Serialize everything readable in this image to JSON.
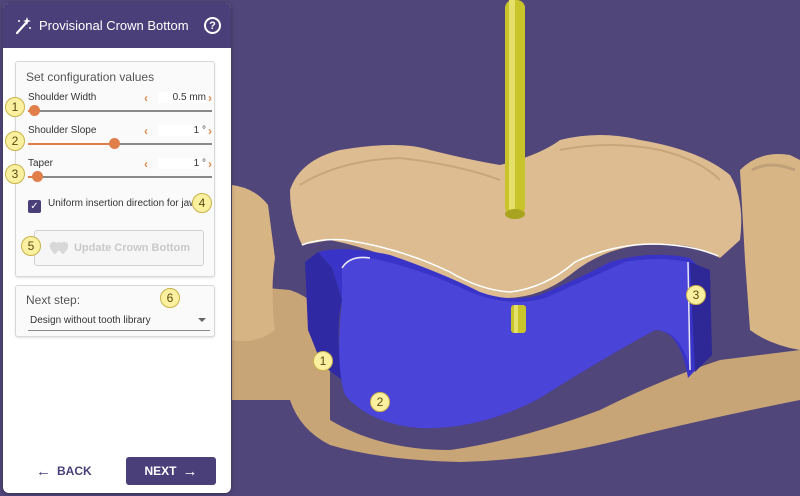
{
  "panel": {
    "title": "Provisional Crown Bottom",
    "help_icon": "?",
    "config": {
      "title": "Set configuration values",
      "params": [
        {
          "label": "Shoulder Width",
          "value": "0.5 mm",
          "fraction": 0.03
        },
        {
          "label": "Shoulder Slope",
          "value": "1 °",
          "fraction": 0.47
        },
        {
          "label": "Taper",
          "value": "1 °",
          "fraction": 0.05
        }
      ],
      "checkbox": {
        "label": "Uniform insertion direction for jaw",
        "checked": true
      },
      "update_button": "Update Crown Bottom"
    },
    "next_step": {
      "title": "Next step:",
      "selected": "Design without tooth library"
    },
    "back_label": "BACK",
    "next_label": "NEXT"
  },
  "callouts": [
    "1",
    "2",
    "3",
    "4",
    "5",
    "6"
  ],
  "colors": {
    "header": "#4a3f78",
    "accent": "#e07f4a",
    "background": "#51467a",
    "crown_bottom": "#3a33c8",
    "tooth": "#d9b78a"
  }
}
